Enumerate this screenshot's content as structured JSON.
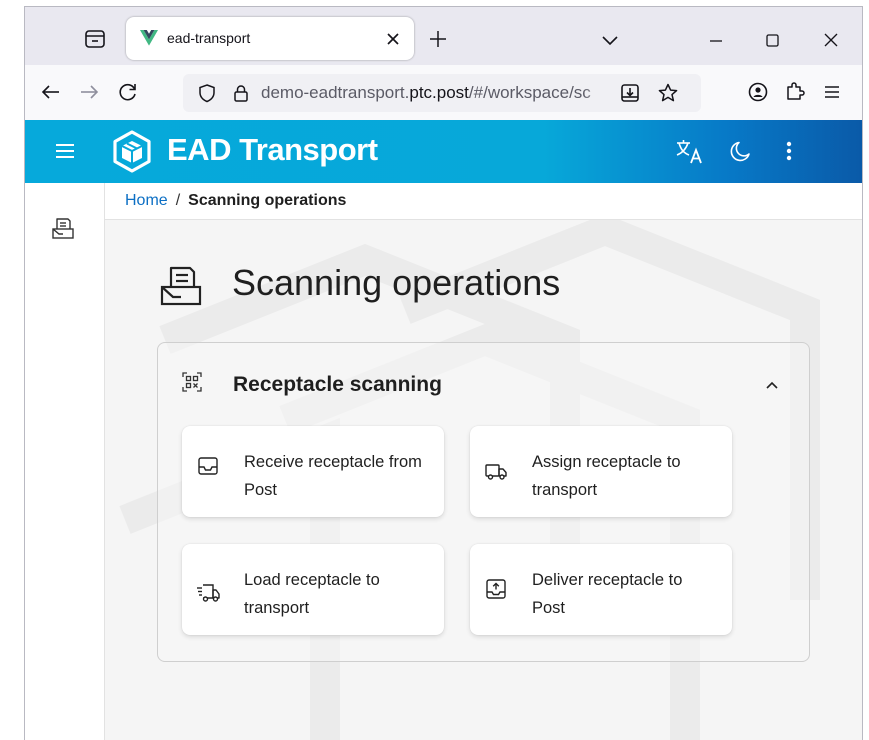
{
  "browser": {
    "tab": {
      "title": "ead-transport",
      "favicon": "vue-logo-icon"
    },
    "url": {
      "host": "demo-eadtransport.",
      "domain": "ptc.post",
      "path": "/#/workspace/sc"
    }
  },
  "app": {
    "title": "EAD Transport",
    "brand_color": "#06a9db",
    "header_icons": [
      "translate-icon",
      "dark-mode-icon",
      "more-vert-icon"
    ]
  },
  "breadcrumb": {
    "home": "Home",
    "separator": "/",
    "current": "Scanning operations"
  },
  "page": {
    "title": "Scanning operations"
  },
  "panel": {
    "title": "Receptacle scanning",
    "expanded": true,
    "cards": [
      {
        "label": "Receive receptacle from Post",
        "icon": "inbox-icon"
      },
      {
        "label": "Assign receptacle to transport",
        "icon": "truck-icon"
      },
      {
        "label": "Load receptacle to transport",
        "icon": "fast-truck-icon"
      },
      {
        "label": "Deliver receptacle to Post",
        "icon": "outbox-upload-icon"
      }
    ]
  }
}
